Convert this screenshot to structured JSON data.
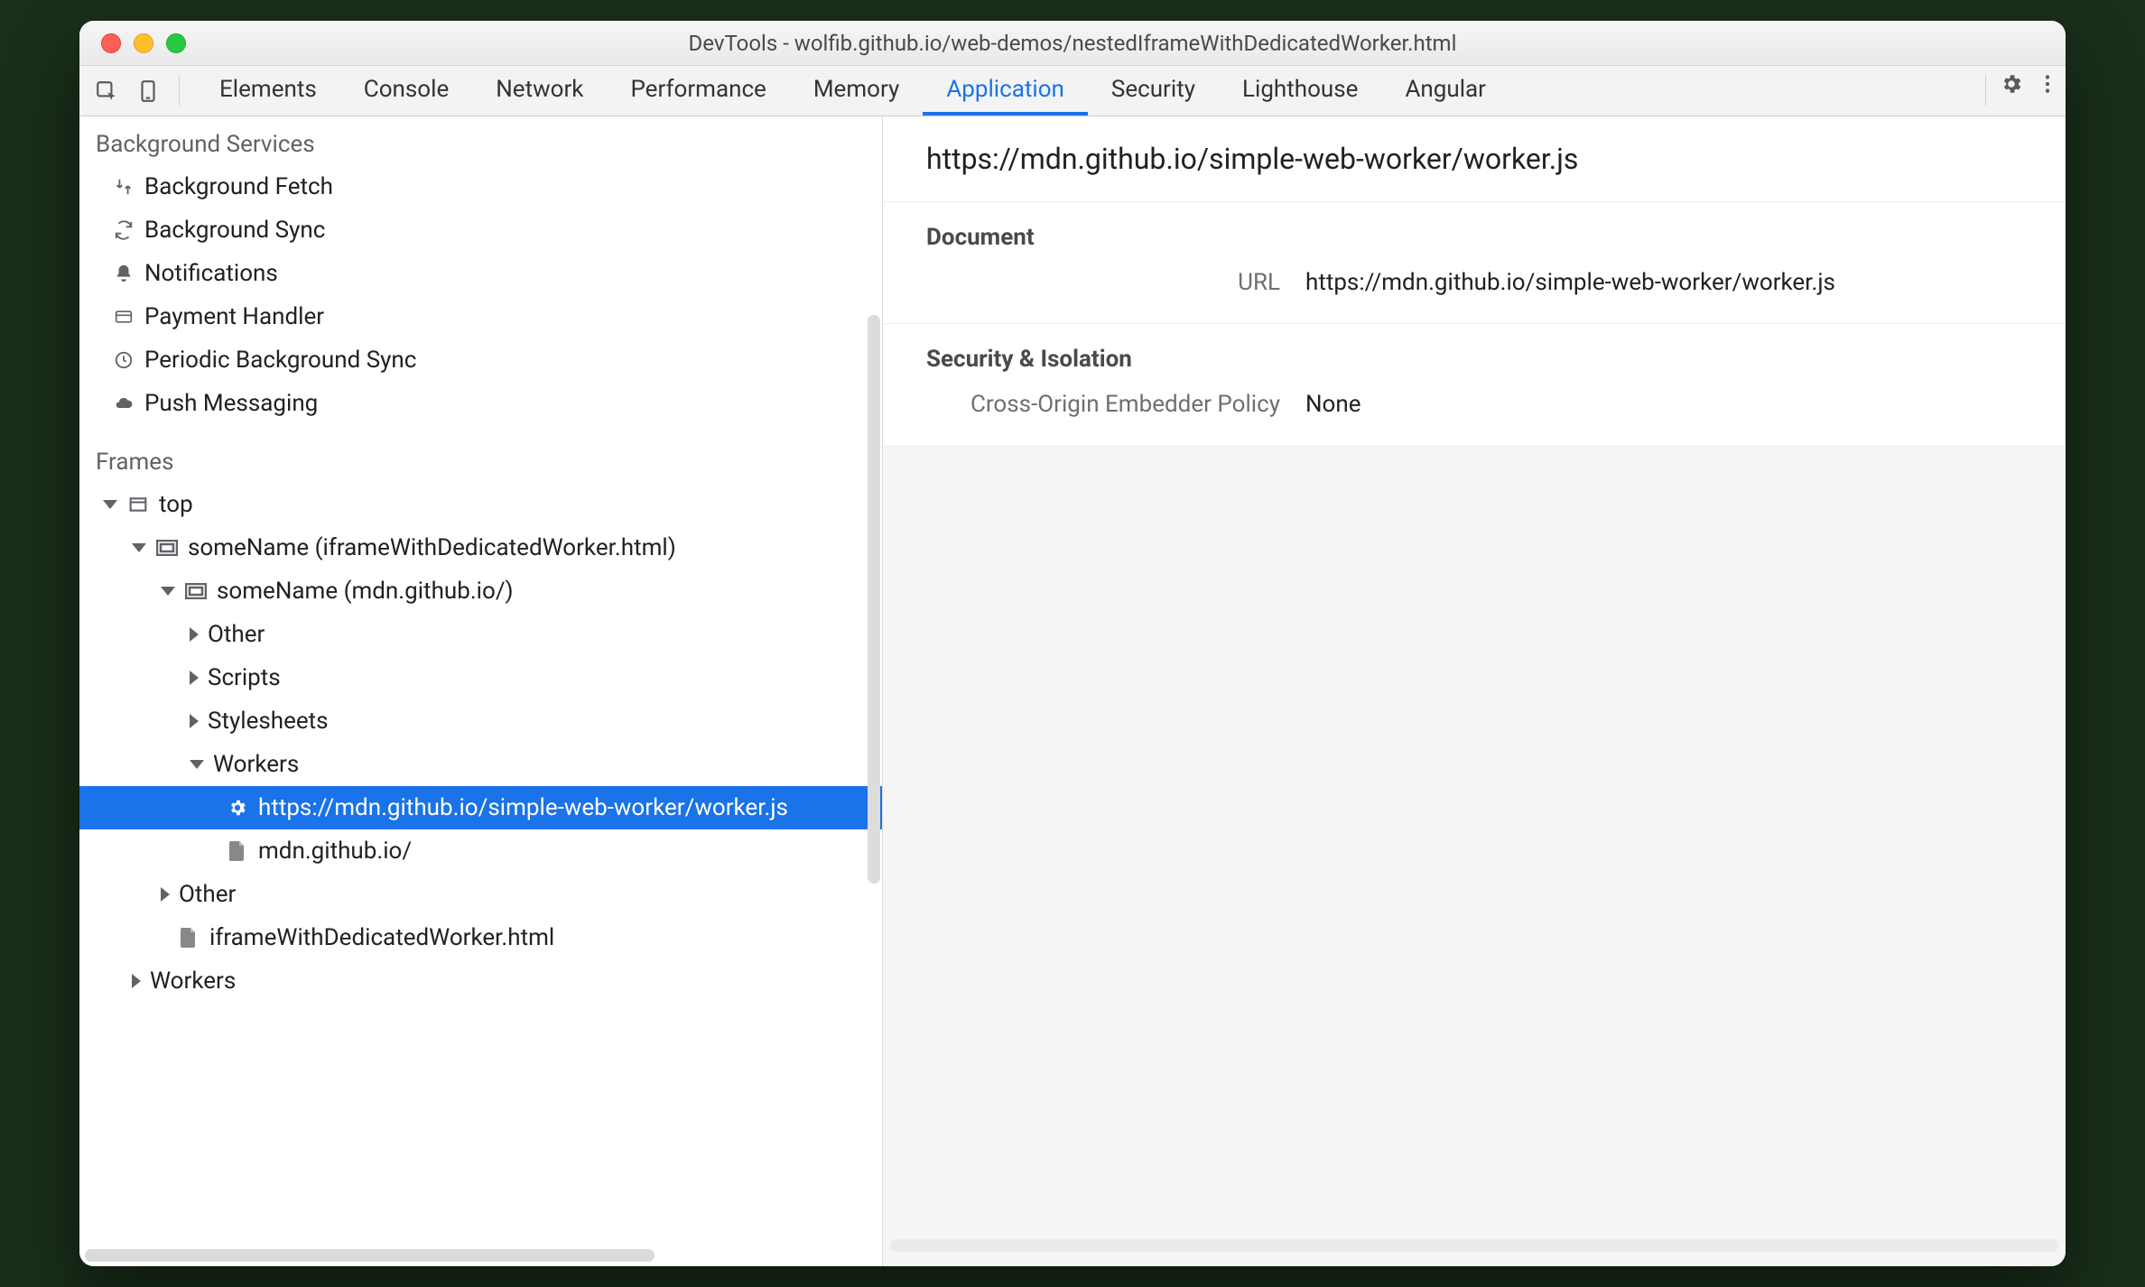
{
  "window": {
    "title": "DevTools - wolfib.github.io/web-demos/nestedIframeWithDedicatedWorker.html"
  },
  "tabs": [
    "Elements",
    "Console",
    "Network",
    "Performance",
    "Memory",
    "Application",
    "Security",
    "Lighthouse",
    "Angular"
  ],
  "active_tab": "Application",
  "sidebar": {
    "bg_title": "Background Services",
    "bg_items": [
      {
        "icon": "fetch",
        "label": "Background Fetch"
      },
      {
        "icon": "sync",
        "label": "Background Sync"
      },
      {
        "icon": "bell",
        "label": "Notifications"
      },
      {
        "icon": "card",
        "label": "Payment Handler"
      },
      {
        "icon": "clock",
        "label": "Periodic Background Sync"
      },
      {
        "icon": "cloud",
        "label": "Push Messaging"
      }
    ],
    "frames_title": "Frames",
    "tree": {
      "top_label": "top",
      "f1_label": "someName (iframeWithDedicatedWorker.html)",
      "f2_label": "someName (mdn.github.io/)",
      "other1": "Other",
      "scripts": "Scripts",
      "styles": "Stylesheets",
      "workers": "Workers",
      "worker_item": "https://mdn.github.io/simple-web-worker/worker.js",
      "file_item": "mdn.github.io/",
      "other2": "Other",
      "file2": "iframeWithDedicatedWorker.html",
      "workers2": "Workers"
    }
  },
  "main": {
    "title": "https://mdn.github.io/simple-web-worker/worker.js",
    "doc_heading": "Document",
    "url_label": "URL",
    "url_value": "https://mdn.github.io/simple-web-worker/worker.js",
    "sec_heading": "Security & Isolation",
    "coep_label": "Cross-Origin Embedder Policy",
    "coep_value": "None"
  }
}
